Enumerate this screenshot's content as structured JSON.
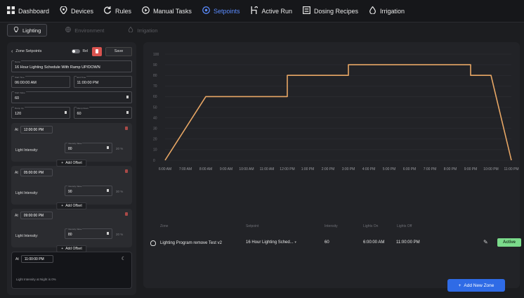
{
  "nav": [
    {
      "label": "Dashboard",
      "icon": "dashboard-grid-icon"
    },
    {
      "label": "Devices",
      "icon": "location-pin-icon"
    },
    {
      "label": "Rules",
      "icon": "refresh-icon"
    },
    {
      "label": "Manual Tasks",
      "icon": "play-circle-icon"
    },
    {
      "label": "Setpoints",
      "icon": "target-icon",
      "active": true
    },
    {
      "label": "Active Run",
      "icon": "route-icon"
    },
    {
      "label": "Dosing Recipes",
      "icon": "list-icon"
    },
    {
      "label": "Irrigation",
      "icon": "water-drop-icon"
    }
  ],
  "subtabs": [
    {
      "label": "Lighting",
      "active": true
    },
    {
      "label": "Environment"
    },
    {
      "label": "Irrigation"
    }
  ],
  "zone_setpoints": {
    "title": "Zone Setpoints",
    "rel_label": "Rel",
    "save_label": "Save",
    "name_label": "Name",
    "name_value": "16 Hour Lighting Schedule With Ramp UP/DOWN",
    "start_time_label": "Start Time",
    "start_time_value": "06:00:00 AM",
    "end_time_label": "End Time",
    "end_time_value": "11:00:00 PM",
    "start_value_label": "Start Value",
    "start_value": "60",
    "ramp_up_label": "Ramp Up",
    "ramp_up_value": "120",
    "ramp_down_label": "Ramp Down",
    "ramp_down_value": "60"
  },
  "offsets": [
    {
      "at_label": "At",
      "time": "12:00:00 PM",
      "light_label": "Light Intensity:",
      "iv_label": "Intensity Value",
      "iv": "80",
      "pct": "20 %",
      "add_label": "Add Offset"
    },
    {
      "at_label": "At",
      "time": "05:00:00 PM",
      "light_label": "Light Intensity:",
      "iv_label": "Intensity Value",
      "iv": "90",
      "pct": "30 %",
      "add_label": "Add Offset"
    },
    {
      "at_label": "At",
      "time": "09:00:00 PM",
      "light_label": "Light Intensity:",
      "iv_label": "Intensity Value",
      "iv": "80",
      "pct": "20 %",
      "add_label": "Add Offset"
    }
  ],
  "night": {
    "at_label": "At",
    "time": "11:00:00 PM",
    "note": "Light Intensity at Night is 0%"
  },
  "chart_data": {
    "type": "line",
    "title": "",
    "xlabel": "",
    "ylabel": "",
    "ylim": [
      0,
      100
    ],
    "yticks": [
      0,
      10,
      20,
      30,
      40,
      50,
      60,
      70,
      80,
      90,
      100
    ],
    "xticks": [
      "6:00 AM",
      "7:00 AM",
      "8:00 AM",
      "9:00 AM",
      "10:00 AM",
      "11:00 AM",
      "12:00 PM",
      "1:00 PM",
      "2:00 PM",
      "3:00 PM",
      "4:00 PM",
      "5:00 PM",
      "6:00 PM",
      "7:00 PM",
      "8:00 PM",
      "9:00 PM",
      "10:00 PM",
      "11:00 PM"
    ],
    "grid": true,
    "line_color": "#e8a765",
    "series": [
      {
        "x": [
          "6:00 AM",
          "8:00 AM",
          "12:00 PM",
          "12:00 PM",
          "3:00 PM",
          "3:00 PM",
          "9:00 PM",
          "9:00 PM",
          "10:00 PM",
          "11:00 PM"
        ],
        "y": [
          0,
          60,
          60,
          80,
          80,
          90,
          90,
          80,
          80,
          0
        ]
      }
    ]
  },
  "table": {
    "headers": [
      "Zone",
      "Setpoint",
      "Intensity",
      "Lights On",
      "Lights Off"
    ],
    "row": {
      "zone": "Lighting Program remove Test v2",
      "setpoint": "16 Hour Lighting Sched...",
      "intensity": "60",
      "lights_on": "6:00:00 AM",
      "lights_off": "11:00:00 PM",
      "status": "Active"
    }
  },
  "add_zone_label": "Add New Zone",
  "colors": {
    "accent": "#5b8cff",
    "active_badge": "#7bdb8b",
    "primary_button": "#2f6be6",
    "delete": "#d9534f"
  }
}
